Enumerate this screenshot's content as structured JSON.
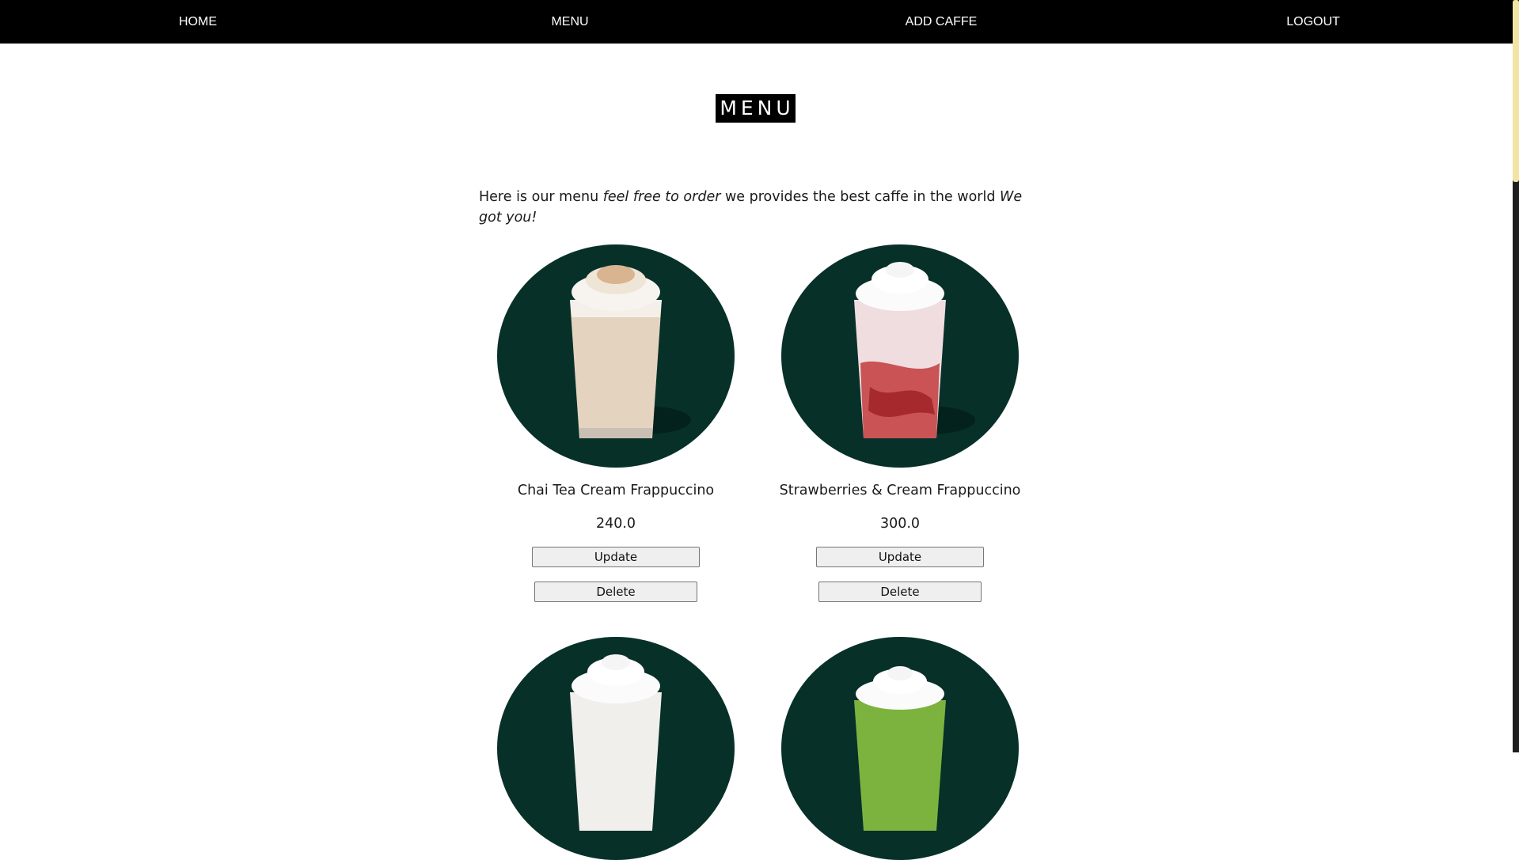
{
  "nav": {
    "home": "HOME",
    "menu": "MENU",
    "add_caffe": "ADD CAFFE",
    "logout": "LOGOUT"
  },
  "page": {
    "title": "MENU",
    "intro_plain_1": "Here is our menu ",
    "intro_em_1": "feel free to order",
    "intro_plain_2": " we provides the best caffe in the world ",
    "intro_em_2": "We got you!"
  },
  "items": [
    {
      "name": "Chai Tea Cream Frappuccino",
      "price": "240.0",
      "update_label": "Update",
      "delete_label": "Delete",
      "drink_color": "#e4d3bf",
      "image": "chai-frappuccino-image"
    },
    {
      "name": "Strawberries & Cream Frappuccino",
      "price": "300.0",
      "update_label": "Update",
      "delete_label": "Delete",
      "drink_color": "#f0dde0",
      "image": "strawberry-frappuccino-image"
    },
    {
      "image": "vanilla-frappuccino-image",
      "drink_color": "#f1efeb"
    },
    {
      "image": "matcha-frappuccino-image",
      "drink_color": "#7cb33f"
    }
  ],
  "colors": {
    "navbar": "#000000",
    "plate": "#073029",
    "scroll_thumb": "#f3e4a4"
  }
}
